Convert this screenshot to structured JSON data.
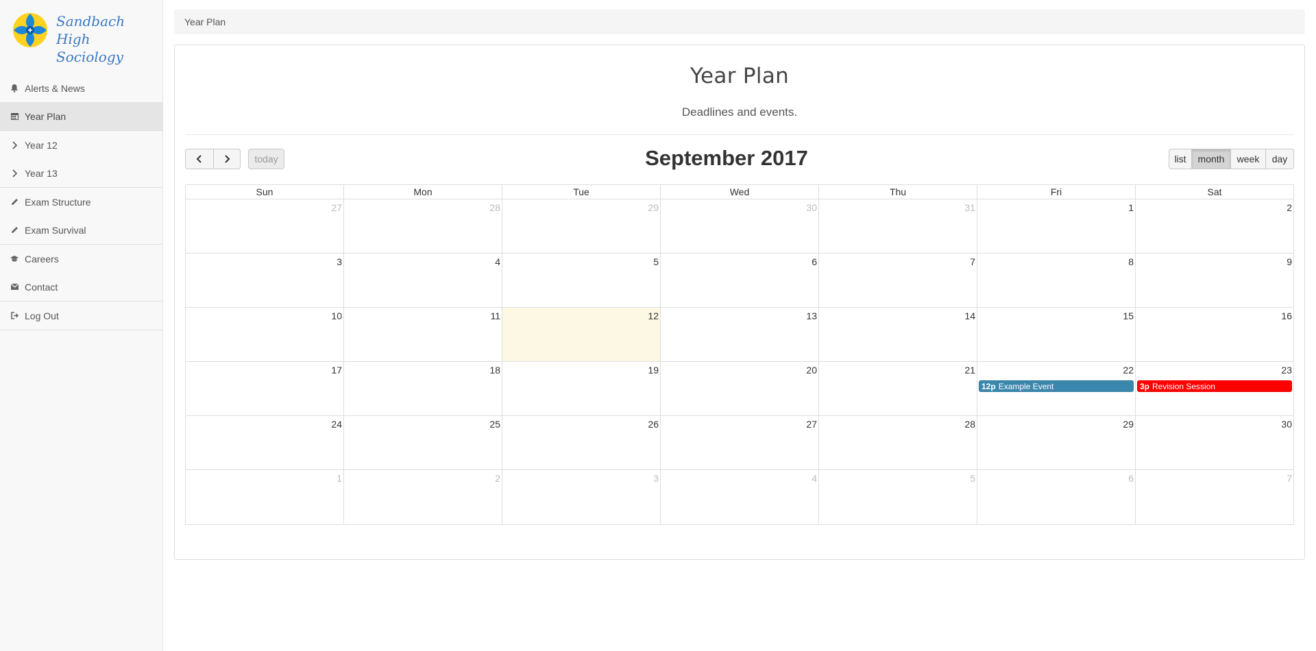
{
  "brand": {
    "line1": "Sandbach High",
    "line2": "Sociology"
  },
  "sidebar": {
    "groups": [
      [
        {
          "label": "Alerts & News",
          "icon": "bell-icon"
        },
        {
          "label": "Year Plan",
          "icon": "calendar-icon",
          "active": true
        }
      ],
      [
        {
          "label": "Year 12",
          "icon": "chevron-right-icon"
        },
        {
          "label": "Year 13",
          "icon": "chevron-right-icon"
        }
      ],
      [
        {
          "label": "Exam Structure",
          "icon": "pencil-icon"
        },
        {
          "label": "Exam Survival",
          "icon": "pencil-icon"
        }
      ],
      [
        {
          "label": "Careers",
          "icon": "graduation-cap-icon"
        },
        {
          "label": "Contact",
          "icon": "envelope-icon"
        }
      ],
      [
        {
          "label": "Log Out",
          "icon": "log-out-icon"
        }
      ]
    ]
  },
  "breadcrumb": "Year Plan",
  "page": {
    "title": "Year Plan",
    "subtitle": "Deadlines and events."
  },
  "calendar": {
    "title": "September 2017",
    "today_label": "today",
    "views": [
      {
        "label": "list",
        "active": false
      },
      {
        "label": "month",
        "active": true
      },
      {
        "label": "week",
        "active": false
      },
      {
        "label": "day",
        "active": false
      }
    ],
    "weekdays": [
      "Sun",
      "Mon",
      "Tue",
      "Wed",
      "Thu",
      "Fri",
      "Sat"
    ],
    "weeks": [
      [
        {
          "d": "27",
          "other": true
        },
        {
          "d": "28",
          "other": true
        },
        {
          "d": "29",
          "other": true
        },
        {
          "d": "30",
          "other": true
        },
        {
          "d": "31",
          "other": true
        },
        {
          "d": "1"
        },
        {
          "d": "2"
        }
      ],
      [
        {
          "d": "3"
        },
        {
          "d": "4"
        },
        {
          "d": "5"
        },
        {
          "d": "6"
        },
        {
          "d": "7"
        },
        {
          "d": "8"
        },
        {
          "d": "9"
        }
      ],
      [
        {
          "d": "10"
        },
        {
          "d": "11"
        },
        {
          "d": "12",
          "today": true
        },
        {
          "d": "13"
        },
        {
          "d": "14"
        },
        {
          "d": "15"
        },
        {
          "d": "16"
        }
      ],
      [
        {
          "d": "17"
        },
        {
          "d": "18"
        },
        {
          "d": "19"
        },
        {
          "d": "20"
        },
        {
          "d": "21"
        },
        {
          "d": "22",
          "event": {
            "time": "12p",
            "title": "Example Event",
            "color": "#3a87ad"
          }
        },
        {
          "d": "23",
          "event": {
            "time": "3p",
            "title": "Revision Session",
            "color": "#ff0000"
          }
        }
      ],
      [
        {
          "d": "24"
        },
        {
          "d": "25"
        },
        {
          "d": "26"
        },
        {
          "d": "27"
        },
        {
          "d": "28"
        },
        {
          "d": "29"
        },
        {
          "d": "30"
        }
      ],
      [
        {
          "d": "1",
          "other": true
        },
        {
          "d": "2",
          "other": true
        },
        {
          "d": "3",
          "other": true
        },
        {
          "d": "4",
          "other": true
        },
        {
          "d": "5",
          "other": true
        },
        {
          "d": "6",
          "other": true
        },
        {
          "d": "7",
          "other": true
        }
      ]
    ]
  },
  "colors": {
    "today_bg": "#fcf8e3",
    "brand_text": "#3a78c2"
  }
}
